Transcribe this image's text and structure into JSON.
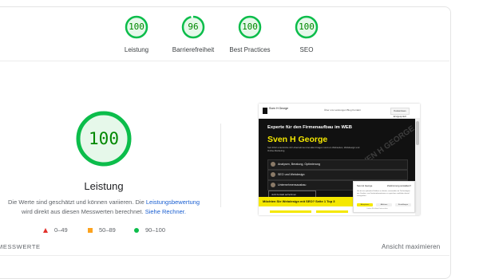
{
  "summary_gauges": [
    {
      "score": "100",
      "label": "Leistung"
    },
    {
      "score": "96",
      "label": "Barrierefreiheit",
      "fraction": 0.96
    },
    {
      "score": "100",
      "label": "Best Practices"
    },
    {
      "score": "100",
      "label": "SEO"
    }
  ],
  "performance": {
    "score": "100",
    "title": "Leistung",
    "desc_part1": "Die Werte sind geschätzt und können variieren. Die ",
    "desc_link1": "Leistungsbewertung",
    "desc_part2": " wird direkt aus diesen Messwerten berechnet. ",
    "desc_link2": "Siehe Rechner."
  },
  "legend": [
    {
      "range": "0–49",
      "shape": "triangle",
      "color": "#e2302a"
    },
    {
      "range": "50–89",
      "shape": "square",
      "color": "#fca31f"
    },
    {
      "range": "90–100",
      "shape": "circle",
      "color": "#0cbd4b"
    }
  ],
  "metrics_header": "MESSWERTE",
  "maximize_label": "Ansicht maximieren",
  "colors": {
    "pass": "#0cbd4b",
    "pass_text": "#008800",
    "pass_bg": "#e6f8ea",
    "link": "#1a5fd1"
  },
  "screenshot": {
    "logo_text": "Sven H George",
    "nav": "Über uns   Leistungen   Blog   Kontakt",
    "cta": "Kostenloses Erstgespräch",
    "hero_sub": "Experte für den Firmenaufbau im WEB",
    "hero_name": "Sven H George",
    "hero_para": "Seit 2012 unterstütze ich Unternehmen bei allen Fragen rund um Webseiten, Webdesign und Online-Marketing.",
    "watermark": "SVEN H GEORGE",
    "services": [
      "Analysen, Beratung, Optimierung",
      "SEO und Webdesign",
      "Unternehmensausbau"
    ],
    "contact": "Jetzt Kontakt aufnehmen",
    "banner": "Möchten Sie Webdesign mit SEO? Seite 1 Top 3",
    "cookie_title": "Sven H George",
    "cookie_heading": "Zustimmung verwalten",
    "cookie_text": "Um dir ein optimales Erlebnis zu bieten, verwenden wir Technologien wie Cookies, um Geräteinformationen zu speichern und/oder darauf zuzugreifen.",
    "cookie_btn1": "Akzeptieren",
    "cookie_btn2": "Ablehnen",
    "cookie_btn3": "Einstellungen",
    "cookie_links": "Cookie-Richtlinie   Datenschutz"
  }
}
